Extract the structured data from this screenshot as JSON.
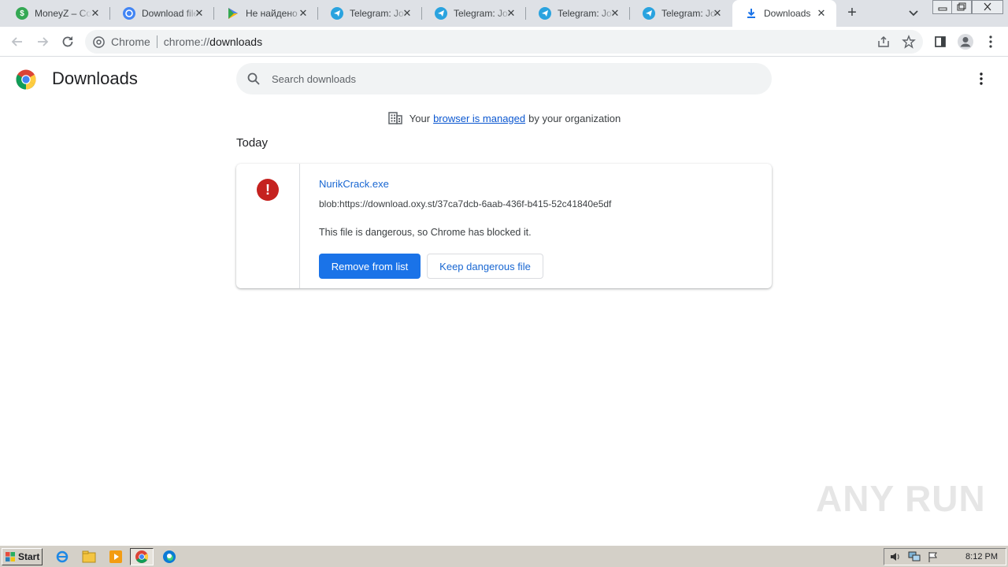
{
  "tabs": [
    {
      "title": "MoneyZ – Com",
      "icon": "moneyz-icon",
      "color": "#34a853"
    },
    {
      "title": "Download file",
      "icon": "download-file-site-icon",
      "color": "#4285f4"
    },
    {
      "title": "Не найдено",
      "icon": "google-play-icon",
      "color": "#ea4335"
    },
    {
      "title": "Telegram: Join",
      "icon": "telegram-icon",
      "color": "#2aa3df"
    },
    {
      "title": "Telegram: Join",
      "icon": "telegram-icon",
      "color": "#2aa3df"
    },
    {
      "title": "Telegram: Join",
      "icon": "telegram-icon",
      "color": "#2aa3df"
    },
    {
      "title": "Telegram: Join",
      "icon": "telegram-icon",
      "color": "#2aa3df"
    },
    {
      "title": "Downloads",
      "icon": "download-icon",
      "color": "#1a73e8",
      "active": true
    }
  ],
  "toolbar": {
    "chip_label": "Chrome",
    "url_scheme": "chrome://",
    "url_host": "downloads"
  },
  "page": {
    "title": "Downloads",
    "search_placeholder": "Search downloads",
    "managed": {
      "prefix": "Your",
      "link": "browser is managed",
      "suffix": "by your organization"
    },
    "section_date": "Today"
  },
  "download": {
    "filename": "NurikCrack.exe",
    "url": "blob:https://download.oxy.st/37ca7dcb-6aab-436f-b415-52c41840e5df",
    "status": "This file is dangerous, so Chrome has blocked it.",
    "remove_label": "Remove from list",
    "keep_label": "Keep dangerous file",
    "danger_color": "#c5221f"
  },
  "watermark": "ANY RUN",
  "taskbar": {
    "start_label": "Start",
    "clock": "8:12 PM"
  },
  "colors": {
    "accent": "#1a73e8",
    "tabstrip": "#dee1e6"
  }
}
